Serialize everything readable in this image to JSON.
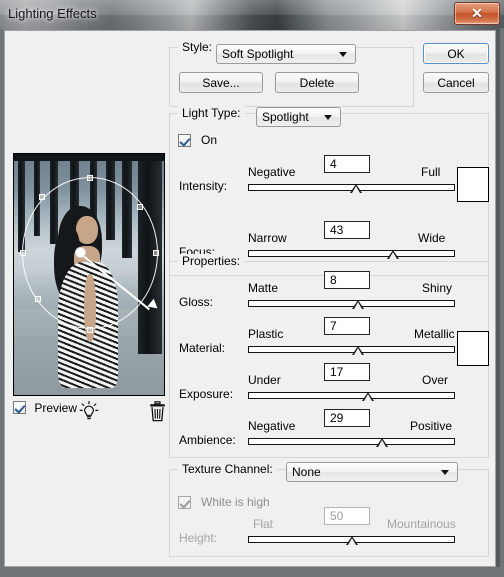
{
  "window": {
    "title": "Lighting Effects",
    "close_label": "✕",
    "close_icon": "close-icon"
  },
  "preview": {
    "checkbox_label": "Preview",
    "checked": true,
    "light_icon": "light-bulb-icon",
    "delete_icon": "trash-icon"
  },
  "buttons": {
    "ok": "OK",
    "cancel": "Cancel",
    "save": "Save...",
    "delete": "Delete"
  },
  "style_group": {
    "label": "Style:",
    "selected": "Soft Spotlight"
  },
  "light_type_group": {
    "label": "Light Type:",
    "selected": "Spotlight",
    "on_label": "On",
    "on_checked": true,
    "sliders": [
      {
        "name": "Intensity:",
        "min_label": "Negative",
        "max_label": "Full",
        "value": "4",
        "percent": 52,
        "disabled": false
      },
      {
        "name": "Focus:",
        "min_label": "Narrow",
        "max_label": "Wide",
        "value": "43",
        "percent": 70,
        "disabled": false
      }
    ],
    "color_swatch": "#ffffff"
  },
  "properties_group": {
    "label": "Properties:",
    "sliders": [
      {
        "name": "Gloss:",
        "min_label": "Matte",
        "max_label": "Shiny",
        "value": "8",
        "percent": 53,
        "disabled": false
      },
      {
        "name": "Material:",
        "min_label": "Plastic",
        "max_label": "Metallic",
        "value": "7",
        "percent": 53,
        "disabled": false
      },
      {
        "name": "Exposure:",
        "min_label": "Under",
        "max_label": "Over",
        "value": "17",
        "percent": 58,
        "disabled": false
      },
      {
        "name": "Ambience:",
        "min_label": "Negative",
        "max_label": "Positive",
        "value": "29",
        "percent": 65,
        "disabled": false
      }
    ],
    "color_swatch": "#ffffff"
  },
  "texture_group": {
    "label": "Texture Channel:",
    "selected": "None",
    "white_is_high_label": "White is high",
    "white_is_high_checked": true,
    "white_is_high_disabled": true,
    "height_slider": {
      "name": "Height:",
      "min_label": "Flat",
      "max_label": "Mountainous",
      "value": "50",
      "percent": 50,
      "disabled": true
    }
  },
  "colors": {
    "dialog_bg": "#f0f0f0",
    "group_border": "#d6d6d6",
    "accent_blue": "#5b8fc9",
    "close_red": "#c2522c",
    "swatch_white": "#ffffff"
  }
}
